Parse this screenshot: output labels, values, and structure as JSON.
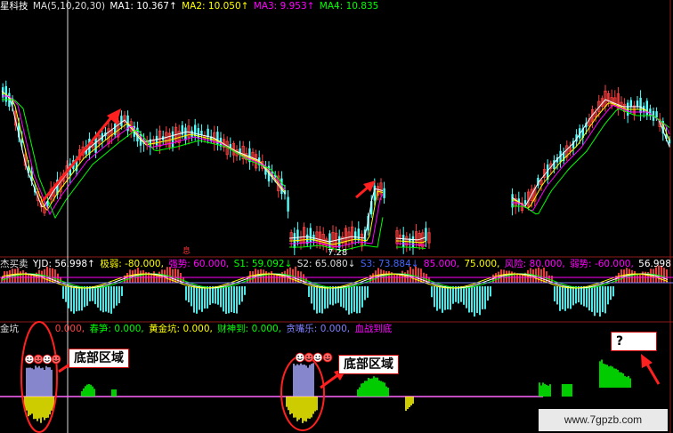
{
  "header": {
    "stock_name": "星科技",
    "ma_label": "MA(5,10,20,30)",
    "ma1": "MA1: 10.367↑",
    "ma2": "MA2: 10.050↑",
    "ma3": "MA3: 9.953↑",
    "ma4": "MA4: 10.835"
  },
  "price_panel": {
    "low_label": "7.28",
    "marker_label": "息"
  },
  "indicator2": {
    "name": "杰买卖",
    "yjd": "YJD: 56.998↑",
    "jiruo": "极弱: -80.000,",
    "qiangshi": "强势: 60.000,",
    "s1": "S1: 59.092↓",
    "s2": "S2: 65.080↓",
    "s3": "S3: 73.884↓",
    "v85": "85.000,",
    "v75": "75.000,",
    "fengxian": "风险: 80.000,",
    "ruoshi": "弱势: -60.000,",
    "last": "56.998↑"
  },
  "indicator3": {
    "name": "金坑",
    "zero": "0.000,",
    "chunsun": "春笋: 0.000,",
    "huangjinkeng": "黄金坑: 0.000,",
    "caishendao": "财神到: 0.000,",
    "tanzuile": "贪嘴乐: 0.000,",
    "xuezhan": "血战到底"
  },
  "callouts": {
    "bottom_zone_1": "底部区域",
    "bottom_zone_2": "底部区域",
    "question": "?"
  },
  "watermark": "www.7gpzb.com",
  "colors": {
    "background": "#000000",
    "up": "#ff4040",
    "down": "#54ffff",
    "ma1": "#ffffff",
    "ma2": "#ffff00",
    "ma3": "#ff00ff",
    "ma4": "#00ff00",
    "arrow": "#ff2020"
  }
}
